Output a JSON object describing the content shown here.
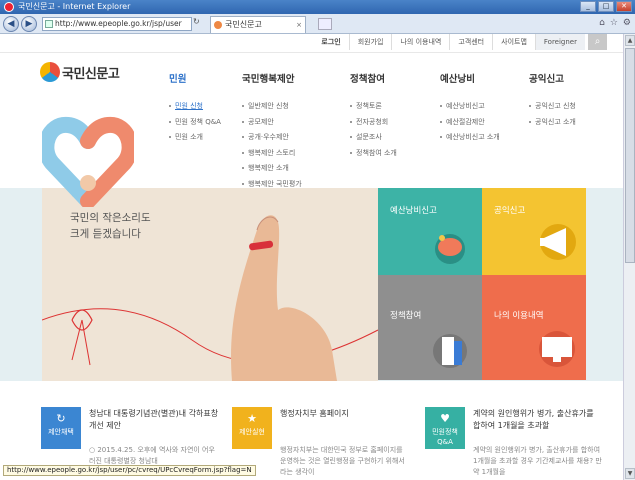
{
  "window": {
    "title": "국민신문고 - Internet Explorer"
  },
  "browser": {
    "address": "http://www.epeople.go.kr/jsp/user",
    "tab_title": "국민신문고"
  },
  "utility": {
    "links": [
      "로그인",
      "회원가입",
      "나의 이용내역",
      "고객센터",
      "사이트맵",
      "Foreigner"
    ]
  },
  "logo": {
    "text": "국민신문고"
  },
  "menu": [
    {
      "head": "민원",
      "items": [
        "민원 신청",
        "민원 정책 Q&A",
        "민원 소개"
      ]
    },
    {
      "head": "국민행복제안",
      "items": [
        "일반제안 신청",
        "공모제안",
        "공개·우수제안",
        "행복제안 스토리",
        "행복제안 소개",
        "행복제안 국민평가"
      ]
    },
    {
      "head": "정책참여",
      "items": [
        "정책토론",
        "전자공청회",
        "설문조사",
        "정책참여 소개"
      ]
    },
    {
      "head": "예산낭비",
      "items": [
        "예산낭비신고",
        "예산절감제안",
        "예산낭비신고 소개"
      ]
    },
    {
      "head": "공익신고",
      "items": [
        "공익신고 신청",
        "공익신고 소개"
      ]
    }
  ],
  "hero": {
    "text_line1": "국민의 작은소리도",
    "text_line2": "크게 듣겠습니다"
  },
  "tiles": [
    "예산낭비신고",
    "공익신고",
    "정책참여",
    "나의 이용내역"
  ],
  "cards": [
    {
      "icon_label": "제안채택",
      "title": "청남대 대통령기념관(별관)내 각하표창 개선 제안",
      "desc": "○ 2015.4.25. 오후에 역사와 자연이 어우러진 대통령별장 청남대"
    },
    {
      "icon_label": "제안실현",
      "title": "행정자치부 홈페이지",
      "desc": "행정자치부는 대한민국 정부로 홈페이지를 운영하는 것은 열린행정을 구현하기 위해서라는 생각이"
    },
    {
      "icon_label": "민원정책 Q&A",
      "title": "계약의 원인행위가 병가, 출산휴가를 합하여 1개월을 초과할",
      "desc": "계약의 원인행위가 병가, 출산휴가를 합하여 1개월을 초과할 경우 기간제교사를 채용? 만약 1개월을"
    }
  ],
  "status_url": "http://www.epeople.go.kr/jsp/user/pc/cvreq/UPcCvreqForm.jsp?flag=N"
}
